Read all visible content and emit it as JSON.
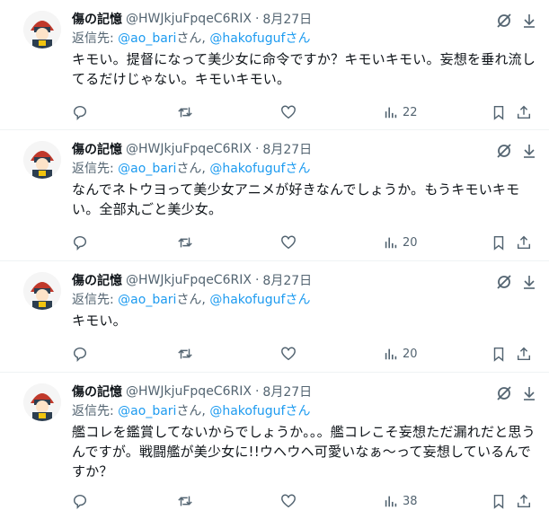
{
  "tweets": [
    {
      "author": {
        "name": "傷の記憶",
        "handle": "@HWJkjuFpqeC6RIX",
        "time": "8月27日"
      },
      "reply": {
        "prefix": "返信先: ",
        "mention1": "@ao_bari",
        "sep": "さん, ",
        "mention2": "@hakofugufさん"
      },
      "text": "キモい。提督になって美少女に命令ですか？キモいキモい。妄想を垂れ流してるだけじゃない。キモいキモい。",
      "views": "22"
    },
    {
      "author": {
        "name": "傷の記憶",
        "handle": "@HWJkjuFpqeC6RIX",
        "time": "8月27日"
      },
      "reply": {
        "prefix": "返信先: ",
        "mention1": "@ao_bari",
        "sep": "さん, ",
        "mention2": "@hakofugufさん"
      },
      "text": "なんでネトウヨって美少女アニメが好きなんでしょうか。もうキモいキモい。全部丸ごと美少女。",
      "views": "20"
    },
    {
      "author": {
        "name": "傷の記憶",
        "handle": "@HWJkjuFpqeC6RIX",
        "time": "8月27日"
      },
      "reply": {
        "prefix": "返信先: ",
        "mention1": "@ao_bari",
        "sep": "さん, ",
        "mention2": "@hakofugufさん"
      },
      "text": "キモい。",
      "views": "20"
    },
    {
      "author": {
        "name": "傷の記憶",
        "handle": "@HWJkjuFpqeC6RIX",
        "time": "8月27日"
      },
      "reply": {
        "prefix": "返信先: ",
        "mention1": "@ao_bari",
        "sep": "さん, ",
        "mention2": "@hakofugufさん"
      },
      "text": "艦コレを鑑賞してないからでしょうか。。。艦コレこそ妄想ただ漏れだと思うんですが。戦闘艦が美少女に!!ウヘウヘ可愛いなぁ～って妄想しているんですか？",
      "views": "38"
    }
  ],
  "icons": {
    "avatar": "avatar-image",
    "grok": "grok-icon",
    "more": "more-icon",
    "reply": "reply-icon",
    "retweet": "retweet-icon",
    "like": "like-icon",
    "views": "views-icon",
    "bookmark": "bookmark-icon",
    "share": "share-icon"
  },
  "colors": {
    "link": "#1d9bf0",
    "secondary": "#536471",
    "text": "#0f1419",
    "border": "#eff3f4"
  }
}
